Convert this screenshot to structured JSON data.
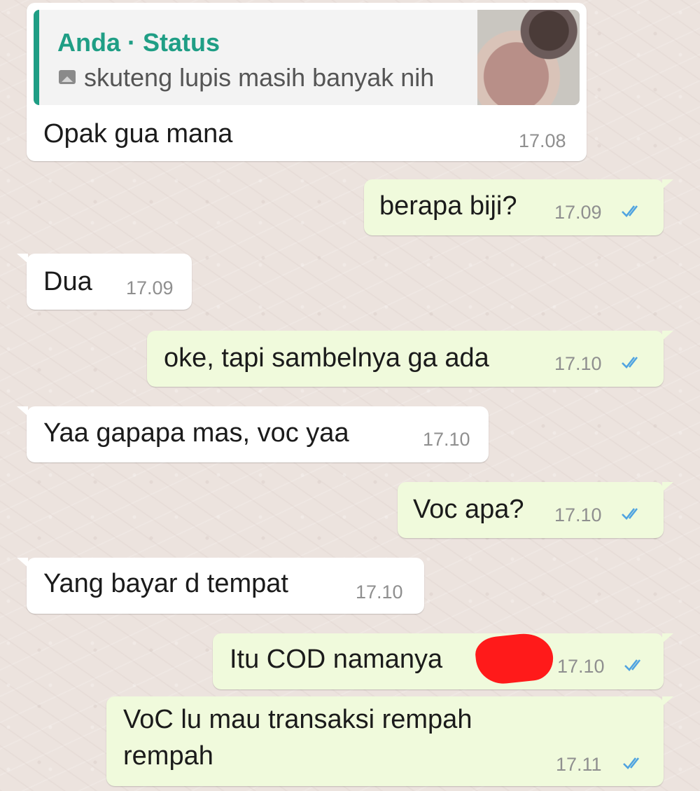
{
  "chat": {
    "quote": {
      "author": "Anda",
      "separator": " · ",
      "type": "Status",
      "preview": "skuteng lupis masih banyak nih"
    },
    "messages": [
      {
        "dir": "in",
        "text": "Opak gua mana",
        "time": "17.08"
      },
      {
        "dir": "out",
        "text": "berapa biji?",
        "time": "17.09",
        "status": "read"
      },
      {
        "dir": "in",
        "text": "Dua",
        "time": "17.09"
      },
      {
        "dir": "out",
        "text": "oke, tapi sambelnya ga ada",
        "time": "17.10",
        "status": "read"
      },
      {
        "dir": "in",
        "text": "Yaa gapapa mas, voc yaa",
        "time": "17.10"
      },
      {
        "dir": "out",
        "text": "Voc apa?",
        "time": "17.10",
        "status": "read"
      },
      {
        "dir": "in",
        "text": "Yang bayar d tempat",
        "time": "17.10"
      },
      {
        "dir": "out",
        "text": "Itu COD namanya",
        "time": "17.10",
        "status": "read"
      },
      {
        "dir": "out",
        "text_line1": "VoC lu mau transaksi rempah",
        "text_line2": "rempah",
        "time": "17.11",
        "status": "read"
      }
    ]
  },
  "colors": {
    "incoming_bubble": "#ffffff",
    "outgoing_bubble": "#f0fadc",
    "quote_accent": "#1f9e85",
    "read_ticks": "#4fa3e0",
    "redaction": "#ff1a1a"
  },
  "icons": [
    "photo-icon",
    "double-check-icon"
  ]
}
